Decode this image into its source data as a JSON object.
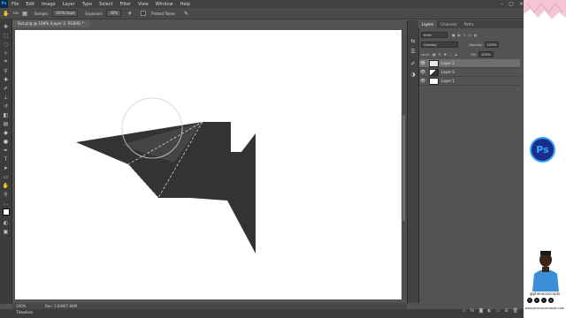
{
  "app": {
    "logo_text": "Ps",
    "menu": [
      "File",
      "Edit",
      "Image",
      "Layer",
      "Type",
      "Select",
      "Filter",
      "View",
      "Window",
      "Help"
    ],
    "window_controls": [
      "–",
      "▢",
      "✕"
    ]
  },
  "options_bar": {
    "sample_label": "Sample:",
    "sample_value": "Shiftchape",
    "exposure_label": "Exposure:",
    "exposure_value": "30%",
    "protect_tones_label": "Protect Tones",
    "brush_size": "500"
  },
  "document": {
    "tab_title": "But.png @ 100% (Layer 2, RGB/8) *",
    "zoom": "100%",
    "doc_size": "Doc: 2.64M/7.84M"
  },
  "timeline_label": "Timeline",
  "layers_panel": {
    "tabs": [
      "Layers",
      "Channels",
      "Paths"
    ],
    "active_tab": "Layers",
    "kind_label": "Kind",
    "blend_mode": "Overlay",
    "opacity_label": "Opacity:",
    "opacity_value": "100%",
    "lock_label": "Lock:",
    "fill_label": "Fill:",
    "fill_value": "100%",
    "layers": [
      {
        "name": "Layer 2",
        "selected": true
      },
      {
        "name": "Layer 0",
        "selected": false
      },
      {
        "name": "Layer 1",
        "selected": false
      }
    ],
    "footer_icons": [
      "link-icon",
      "fx-icon",
      "mask-icon",
      "adjustment-icon",
      "folder-icon",
      "new-layer-icon",
      "trash-icon"
    ]
  },
  "branding": {
    "badge_text": "Ps",
    "handle": "@phenoconcepts",
    "url": "www.phenoconcepts.com",
    "socials": [
      "f",
      "t",
      "i",
      "y"
    ]
  },
  "colors": {
    "ui_dark": "#424242",
    "panel": "#535353",
    "canvas": "#ffffff",
    "shape": "#333333",
    "accent_blue": "#31a8ff"
  }
}
